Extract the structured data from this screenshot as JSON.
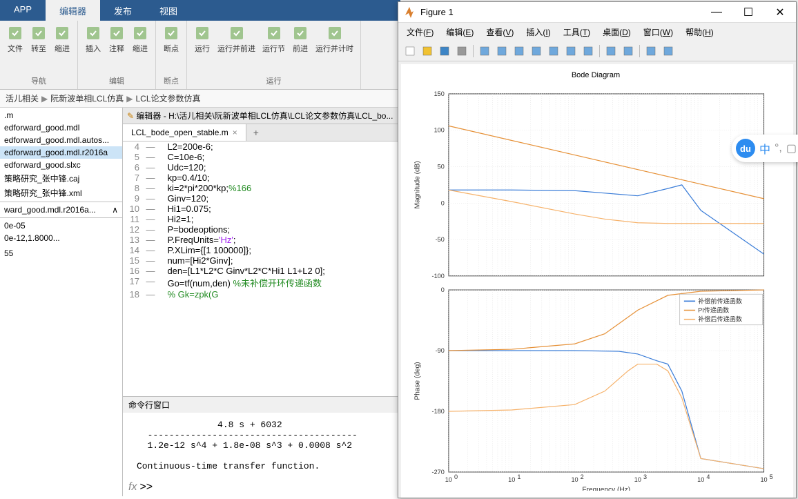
{
  "matlab": {
    "tabs": [
      "APP",
      "编辑器",
      "发布",
      "视图"
    ],
    "activeTab": 1,
    "ribbon": {
      "groups": [
        {
          "label": "导航",
          "items": [
            {
              "t": "文件"
            },
            {
              "t": "转至"
            },
            {
              "t": "缩进"
            }
          ]
        },
        {
          "label": "编辑",
          "items": [
            {
              "t": "插入"
            },
            {
              "t": "注释"
            },
            {
              "t": "缩进"
            }
          ]
        },
        {
          "label": "断点",
          "items": [
            {
              "t": "断点"
            }
          ]
        },
        {
          "label": "运行",
          "items": [
            {
              "t": "运行"
            },
            {
              "t": "运行并前进"
            },
            {
              "t": "运行节"
            },
            {
              "t": "前进"
            },
            {
              "t": "运行并计时"
            }
          ]
        }
      ]
    },
    "breadcrumb": [
      "活儿相关",
      "阮新波单相LCL仿真",
      "LCL论文参数仿真"
    ],
    "files": [
      ".m",
      "edforward_good.mdl",
      "edforward_good.mdl.autos...",
      "edforward_good.mdl.r2016a",
      "edforward_good.slxc",
      "策略研究_张中锋.caj",
      "策略研究_张中锋.xml"
    ],
    "selectedFile": 3,
    "subfile": "ward_good.mdl.r2016a...",
    "wsvals": [
      "0e-05",
      "0e-12,1.8000...",
      "",
      "55"
    ],
    "editorTitle": "编辑器 - H:\\活儿相关\\阮新波单相LCL仿真\\LCL论文参数仿真\\LCL_bo...",
    "openFile": "LCL_bode_open_stable.m",
    "code": [
      {
        "n": 4,
        "t": "L2=200e-6;"
      },
      {
        "n": 5,
        "t": "C=10e-6;"
      },
      {
        "n": 6,
        "t": "Udc=120;"
      },
      {
        "n": 7,
        "t": "kp=0.4/10;"
      },
      {
        "n": 8,
        "t": "ki=2*pi*200*kp;",
        "c": "%166"
      },
      {
        "n": 9,
        "t": "Ginv=120;"
      },
      {
        "n": 10,
        "t": "Hi1=0.075;"
      },
      {
        "n": 11,
        "t": "Hi2=1;"
      },
      {
        "n": 12,
        "t": "P=bodeoptions;"
      },
      {
        "n": 13,
        "t": "P.FreqUnits=",
        "s": "'Hz'",
        "t2": ";"
      },
      {
        "n": 14,
        "t": "P.XLim={[1 100000]};"
      },
      {
        "n": 15,
        "t": "num=[Hi2*Ginv];"
      },
      {
        "n": 16,
        "t": "den=[L1*L2*C Ginv*L2*C*Hi1 L1+L2 0];"
      },
      {
        "n": 17,
        "t": "Go=tf(num,den) ",
        "c": "%未补偿开环传递函数"
      },
      {
        "n": 18,
        "c": "% Gk=zpk(G"
      }
    ],
    "cmdTitle": "命令行窗口",
    "cmdOutput": "               4.8 s + 6032\n  ---------------------------------------\n  1.2e-12 s^4 + 1.8e-08 s^3 + 0.0008 s^2\n\nContinuous-time transfer function.",
    "prompt": ">>"
  },
  "figure": {
    "title": "Figure 1",
    "menus": [
      {
        "label": "文件",
        "u": "F"
      },
      {
        "label": "编辑",
        "u": "E"
      },
      {
        "label": "查看",
        "u": "V"
      },
      {
        "label": "插入",
        "u": "I"
      },
      {
        "label": "工具",
        "u": "T"
      },
      {
        "label": "桌面",
        "u": "D"
      },
      {
        "label": "窗口",
        "u": "W"
      },
      {
        "label": "帮助",
        "u": "H"
      }
    ],
    "plotTitle": "Bode Diagram",
    "xlabel": "Frequency  (Hz)",
    "ylabel1": "Magnitude (dB)",
    "ylabel2": "Phase (deg)",
    "legend": [
      "补偿前传递函数",
      "PI传递函数",
      "补偿后传递函数"
    ],
    "colors": {
      "s1": "#3b7dd8",
      "s2": "#e69138",
      "s3": "#f6b26b"
    }
  },
  "chart_data": [
    {
      "type": "line",
      "title": "Bode Diagram — Magnitude",
      "xlabel": "Frequency (Hz)",
      "ylabel": "Magnitude (dB)",
      "xscale": "log",
      "xlim": [
        1,
        100000
      ],
      "ylim": [
        -100,
        150
      ],
      "yticks": [
        -100,
        -50,
        0,
        50,
        100,
        150
      ],
      "series": [
        {
          "name": "补偿前传递函数",
          "color": "#3b7dd8",
          "x": [
            1,
            10,
            100,
            1000,
            3000,
            5000,
            10000,
            100000
          ],
          "y": [
            18,
            18,
            17,
            10,
            20,
            25,
            -10,
            -70
          ]
        },
        {
          "name": "PI传递函数",
          "color": "#e69138",
          "x": [
            1,
            10,
            100,
            1000,
            10000,
            100000
          ],
          "y": [
            106,
            86,
            66,
            46,
            26,
            6
          ]
        },
        {
          "name": "补偿后传递函数",
          "color": "#f6b26b",
          "x": [
            1,
            10,
            100,
            300,
            1000,
            3000,
            10000,
            100000
          ],
          "y": [
            18,
            2,
            -15,
            -22,
            -27,
            -28,
            -28,
            -28
          ]
        }
      ]
    },
    {
      "type": "line",
      "title": "Bode Diagram — Phase",
      "xlabel": "Frequency (Hz)",
      "ylabel": "Phase (deg)",
      "xscale": "log",
      "xlim": [
        1,
        100000
      ],
      "ylim": [
        -270,
        0
      ],
      "yticks": [
        -270,
        -180,
        -90,
        0
      ],
      "series": [
        {
          "name": "补偿前传递函数",
          "color": "#3b7dd8",
          "x": [
            1,
            100,
            500,
            1000,
            2000,
            3000,
            5000,
            10000,
            100000
          ],
          "y": [
            -90,
            -90,
            -91,
            -95,
            -105,
            -110,
            -150,
            -250,
            -265
          ]
        },
        {
          "name": "PI传递函数",
          "color": "#e69138",
          "x": [
            1,
            10,
            100,
            300,
            1000,
            3000,
            10000,
            100000
          ],
          "y": [
            -90,
            -88,
            -80,
            -65,
            -30,
            -8,
            -2,
            0
          ]
        },
        {
          "name": "补偿后传递函数",
          "color": "#f6b26b",
          "x": [
            1,
            10,
            100,
            300,
            700,
            1000,
            2000,
            3000,
            5000,
            10000,
            100000
          ],
          "y": [
            -180,
            -178,
            -170,
            -150,
            -120,
            -110,
            -110,
            -120,
            -160,
            -250,
            -265
          ]
        }
      ]
    }
  ]
}
